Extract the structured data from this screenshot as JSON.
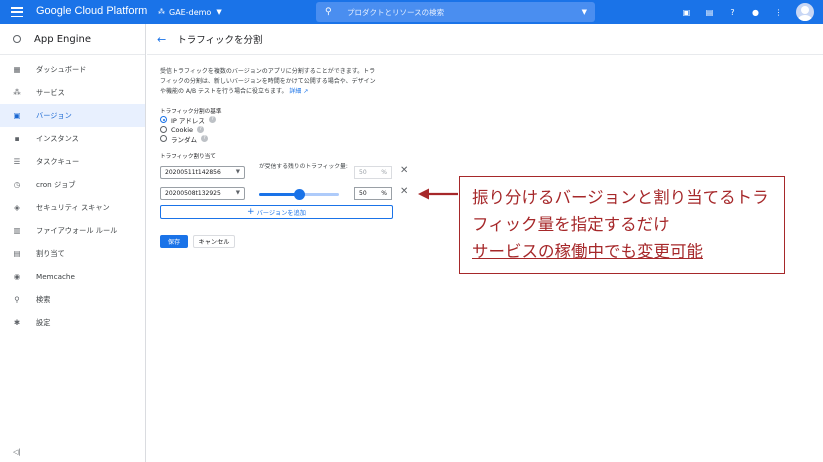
{
  "topbar": {
    "brand": "Google Cloud Platform",
    "project": "GAE-demo",
    "search_placeholder": "プロダクトとリソースの検索"
  },
  "sidebar": {
    "title": "App Engine",
    "items": [
      {
        "label": "ダッシュボード",
        "icon": "dashboard-icon"
      },
      {
        "label": "サービス",
        "icon": "services-icon"
      },
      {
        "label": "バージョン",
        "icon": "versions-icon",
        "active": true
      },
      {
        "label": "インスタンス",
        "icon": "instances-icon"
      },
      {
        "label": "タスクキュー",
        "icon": "task-queue-icon"
      },
      {
        "label": "cron ジョブ",
        "icon": "clock-icon"
      },
      {
        "label": "セキュリティ スキャン",
        "icon": "shield-icon"
      },
      {
        "label": "ファイアウォール ルール",
        "icon": "firewall-icon"
      },
      {
        "label": "割り当て",
        "icon": "quota-icon"
      },
      {
        "label": "Memcache",
        "icon": "memcache-icon"
      },
      {
        "label": "検索",
        "icon": "search-icon"
      },
      {
        "label": "設定",
        "icon": "gear-icon"
      }
    ]
  },
  "page": {
    "title": "トラフィックを分割",
    "description_lines": [
      "受信トラフィックを複数のバージョンのアプリに分割することができます。トラ",
      "フィックの分割は、新しいバージョンを時間をかけて公開する場合や、デザイン",
      "や機能の A/B テストを行う場合に役立ちます。"
    ],
    "learn_more": "詳細",
    "split_basis_label": "トラフィック分割の基準",
    "options": [
      "IP アドレス",
      "Cookie",
      "ランダム"
    ],
    "selected_option": "IP アドレス",
    "allocation_label": "トラフィック割り当て",
    "remaining_label": "が受信する残りのトラフィック量:",
    "versions": [
      {
        "id": "20200511t142856",
        "percent": "50",
        "unit": "%"
      },
      {
        "id": "20200508t132925",
        "percent": "50",
        "unit": "%"
      }
    ],
    "slider_value": 0.5,
    "add_version_label": "バージョンを追加",
    "save_label": "保存",
    "cancel_label": "キャンセル"
  },
  "callout": {
    "line1": "振り分けるバージョンと割り当てるトラ",
    "line2": "フィック量を指定するだけ",
    "line3": "サービスの稼働中でも変更可能",
    "color": "#a6282a"
  }
}
